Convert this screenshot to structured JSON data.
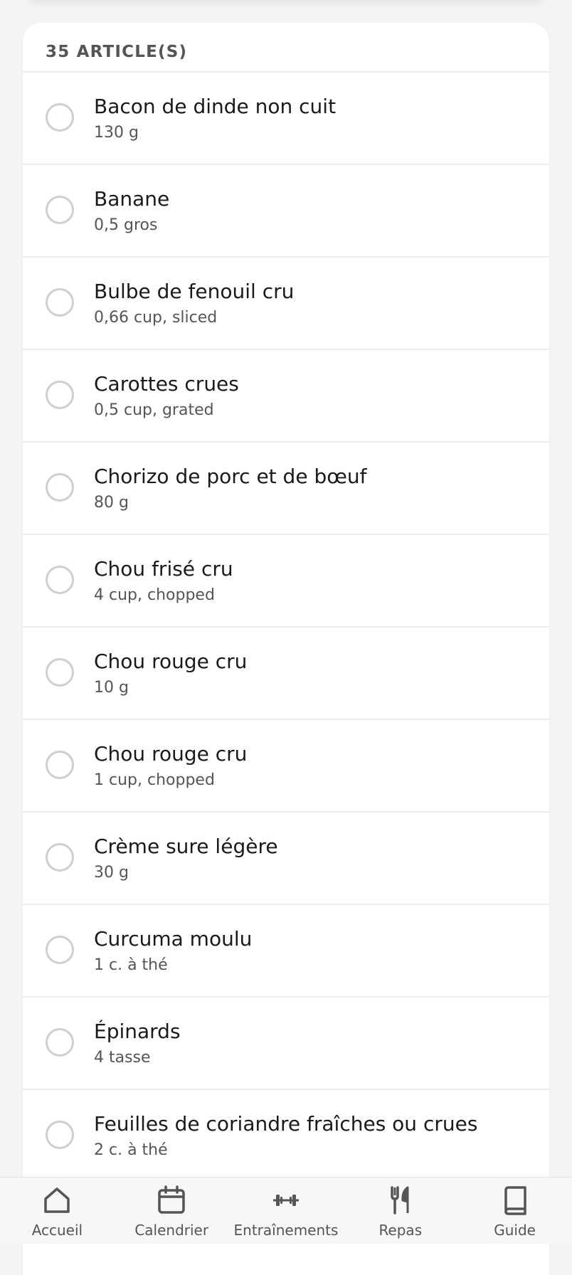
{
  "list": {
    "count_label": "35 ARTICLE(S)",
    "items": [
      {
        "name": "Bacon de dinde non cuit",
        "qty": "130 g"
      },
      {
        "name": "Banane",
        "qty": "0,5 gros"
      },
      {
        "name": "Bulbe de fenouil cru",
        "qty": "0,66 cup, sliced"
      },
      {
        "name": "Carottes crues",
        "qty": "0,5 cup, grated"
      },
      {
        "name": "Chorizo de porc et de bœuf",
        "qty": "80 g"
      },
      {
        "name": "Chou frisé cru",
        "qty": "4 cup, chopped"
      },
      {
        "name": "Chou rouge cru",
        "qty": "10 g"
      },
      {
        "name": "Chou rouge cru",
        "qty": "1 cup, chopped"
      },
      {
        "name": "Crème sure légère",
        "qty": "30 g"
      },
      {
        "name": "Curcuma moulu",
        "qty": "1 c. à thé"
      },
      {
        "name": "Épinards",
        "qty": "4 tasse"
      },
      {
        "name": "Feuilles de coriandre fraîches ou crues",
        "qty": "2 c. à thé"
      }
    ]
  },
  "nav": {
    "items": [
      {
        "label": "Accueil",
        "icon": "home-icon"
      },
      {
        "label": "Calendrier",
        "icon": "calendar-icon"
      },
      {
        "label": "Entraînements",
        "icon": "dumbbell-icon"
      },
      {
        "label": "Repas",
        "icon": "utensils-icon"
      },
      {
        "label": "Guide",
        "icon": "book-icon"
      }
    ]
  }
}
